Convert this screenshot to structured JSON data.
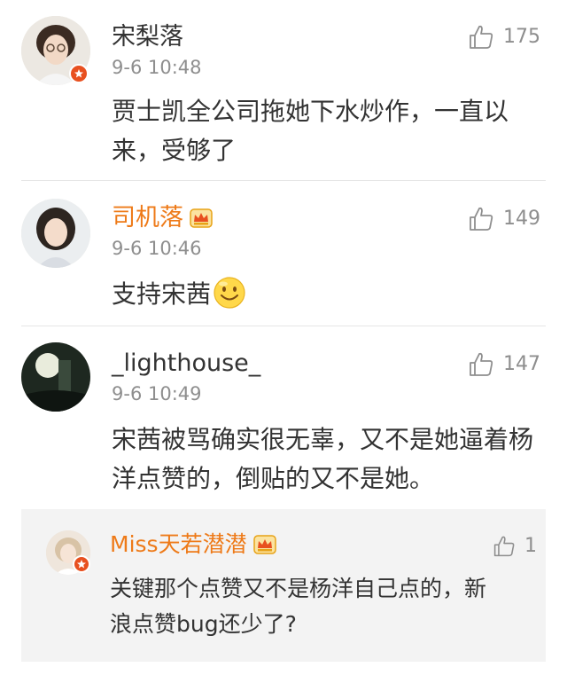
{
  "comments": [
    {
      "username": "宋梨落",
      "time": "9-6 10:48",
      "likes": "175",
      "text": "贾士凯全公司拖她下水炒作，一直以来，受够了"
    },
    {
      "username": "司机落",
      "time": "9-6 10:46",
      "likes": "149",
      "text": "支持宋茜"
    },
    {
      "username": "_lighthouse_",
      "time": "9-6 10:49",
      "likes": "147",
      "text": "宋茜被骂确实很无辜，又不是她逼着杨洋点赞的，倒贴的又不是她。"
    }
  ],
  "reply": {
    "username": "Miss天若潜潜",
    "likes": "1",
    "text": "关键那个点赞又不是杨洋自己点的，新浪点赞bug还少了?"
  },
  "colors": {
    "vip_name": "#ee7a18",
    "meta_gray": "#8e8e8e",
    "badge_red": "#e8501f"
  },
  "icons": [
    "thumbs-up-icon",
    "verified-badge-icon",
    "vip-crown-icon",
    "smile-emoji-icon"
  ]
}
